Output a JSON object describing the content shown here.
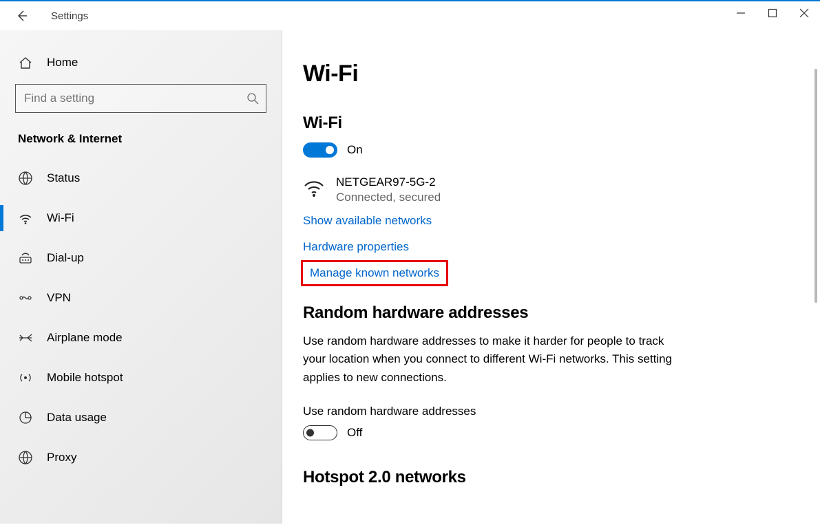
{
  "titlebar": {
    "title": "Settings"
  },
  "sidebar": {
    "home_label": "Home",
    "search_placeholder": "Find a setting",
    "category": "Network & Internet",
    "items": [
      {
        "key": "status",
        "label": "Status"
      },
      {
        "key": "wifi",
        "label": "Wi-Fi"
      },
      {
        "key": "dialup",
        "label": "Dial-up"
      },
      {
        "key": "vpn",
        "label": "VPN"
      },
      {
        "key": "airplane",
        "label": "Airplane mode"
      },
      {
        "key": "hotspot",
        "label": "Mobile hotspot"
      },
      {
        "key": "datausage",
        "label": "Data usage"
      },
      {
        "key": "proxy",
        "label": "Proxy"
      }
    ]
  },
  "main": {
    "page_title": "Wi-Fi",
    "wifi_section_title": "Wi-Fi",
    "wifi_toggle_state": "On",
    "network_name": "NETGEAR97-5G-2",
    "network_status": "Connected, secured",
    "link_show_available": "Show available networks",
    "link_hardware_props": "Hardware properties",
    "link_manage_known": "Manage known networks",
    "random_title": "Random hardware addresses",
    "random_body": "Use random hardware addresses to make it harder for people to track your location when you connect to different Wi-Fi networks. This setting applies to new connections.",
    "random_toggle_label": "Use random hardware addresses",
    "random_toggle_state": "Off",
    "hotspot2_title": "Hotspot 2.0 networks"
  }
}
